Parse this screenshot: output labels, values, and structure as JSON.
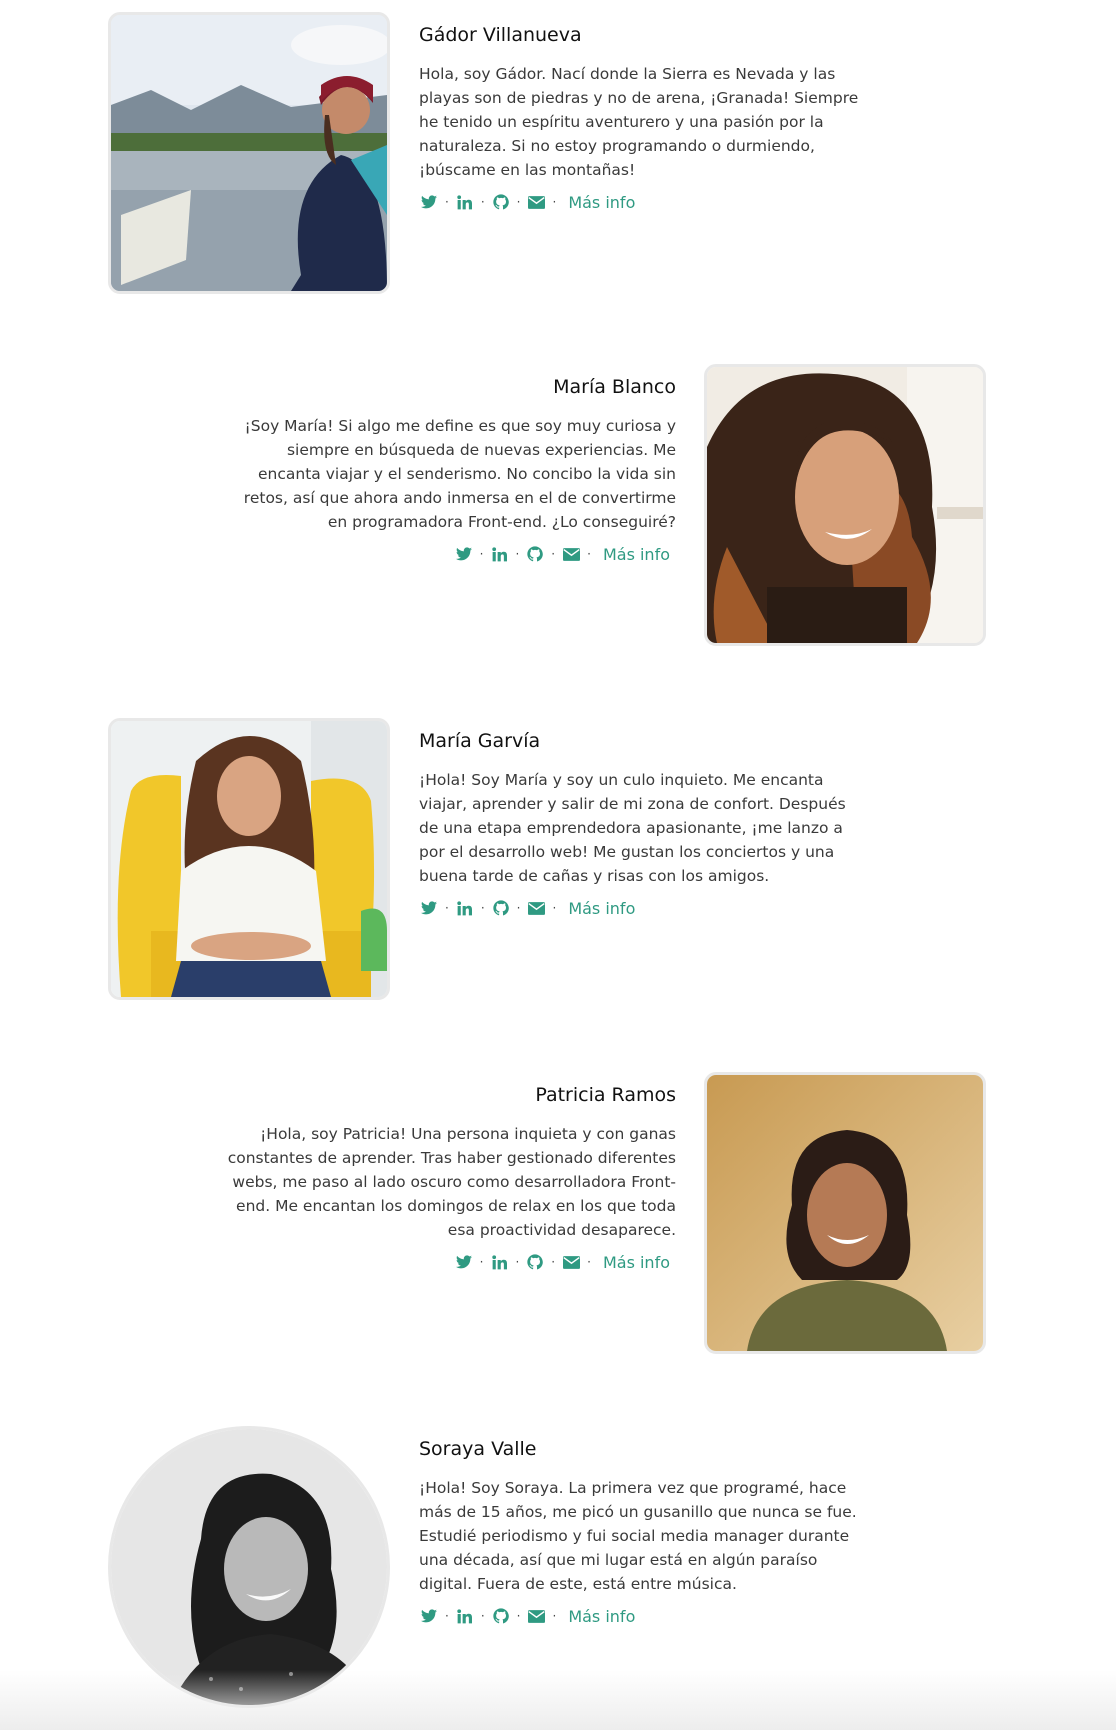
{
  "accent": "#2f9a82",
  "members": [
    {
      "name": "Gádor Villanueva",
      "bio": "Hola, soy Gádor. Nací donde la Sierra es Nevada y las playas son de piedras y no de arena, ¡Granada! Siempre he tenido un espíritu aventurero y una pasión por la naturaleza. Si no estoy programando o durmiendo, ¡búscame en las montañas!",
      "more": "Más info"
    },
    {
      "name": "María Blanco",
      "bio": "¡Soy María! Si algo me define es que soy muy curiosa y siempre en búsqueda de nuevas experiencias. Me encanta viajar y el senderismo. No concibo la vida sin retos, así que ahora ando inmersa en el de convertirme en programadora Front-end. ¿Lo conseguiré?",
      "more": "Más info"
    },
    {
      "name": "María Garvía",
      "bio": "¡Hola! Soy María y soy un culo inquieto. Me encanta viajar, aprender y salir de mi zona de confort. Después de una etapa emprendedora apasionante, ¡me lanzo a por el desarrollo web! Me gustan los conciertos y una buena tarde de cañas y risas con los amigos.",
      "more": "Más info"
    },
    {
      "name": "Patricia Ramos",
      "bio": "¡Hola, soy Patricia! Una persona inquieta y con ganas constantes de aprender. Tras haber gestionado diferentes webs, me paso al lado oscuro como desarrolladora Front-end. Me encantan los domingos de relax en los que toda esa proactividad desaparece.",
      "more": "Más info"
    },
    {
      "name": "Soraya Valle",
      "bio": "¡Hola! Soy Soraya. La primera vez que programé, hace más de 15 años, me picó un gusanillo que nunca se fue. Estudié periodismo y fui social media manager durante una década, así que mi lugar está en algún paraíso digital. Fuera de este, está entre música.",
      "more": "Más info"
    }
  ],
  "icons": [
    "twitter-icon",
    "linkedin-icon",
    "github-icon",
    "envelope-icon"
  ]
}
